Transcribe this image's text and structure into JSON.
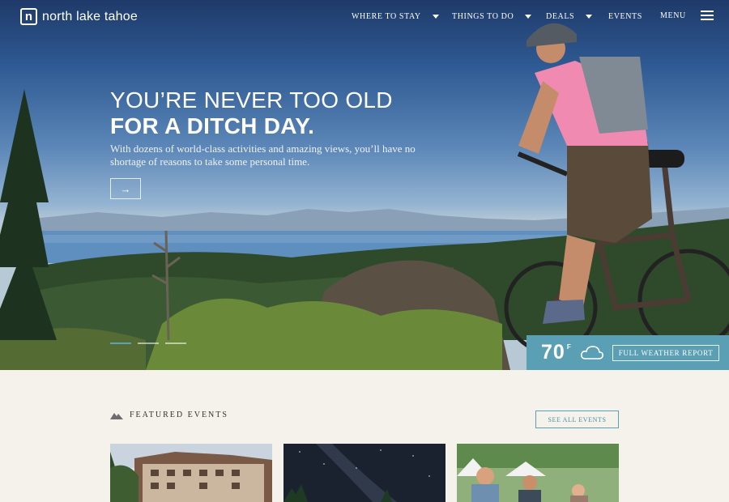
{
  "brand": {
    "logo_letter": "n",
    "name": "north lake tahoe"
  },
  "nav": {
    "items": [
      {
        "label": "WHERE TO STAY",
        "has_dropdown": true
      },
      {
        "label": "THINGS TO DO",
        "has_dropdown": true
      },
      {
        "label": "DEALS",
        "has_dropdown": true
      },
      {
        "label": "EVENTS",
        "has_dropdown": false
      },
      {
        "label": "MENU",
        "icon": "hamburger-icon"
      }
    ]
  },
  "hero": {
    "headline_line1": "YOU’RE NEVER TOO OLD",
    "headline_line2": "FOR A DITCH DAY.",
    "subtext": "With dozens of world-class activities and amazing views, you’ll have no shortage of reasons to take some personal time.",
    "arrow": "→",
    "slides_total": 3,
    "slide_active": 1
  },
  "weather": {
    "temperature": "70",
    "unit": "F",
    "icon": "cloud-icon",
    "button_label": "FULL WEATHER REPORT"
  },
  "featured": {
    "label": "FEATURED EVENTS",
    "icon": "mountain-icon",
    "see_all_label": "SEE ALL EVENTS",
    "cards": [
      {
        "icon": "lodge-photo"
      },
      {
        "icon": "night-sky-photo"
      },
      {
        "icon": "festival-photo"
      }
    ]
  },
  "colors": {
    "accent": "#5a9fb3",
    "background": "#f5f1eb"
  }
}
